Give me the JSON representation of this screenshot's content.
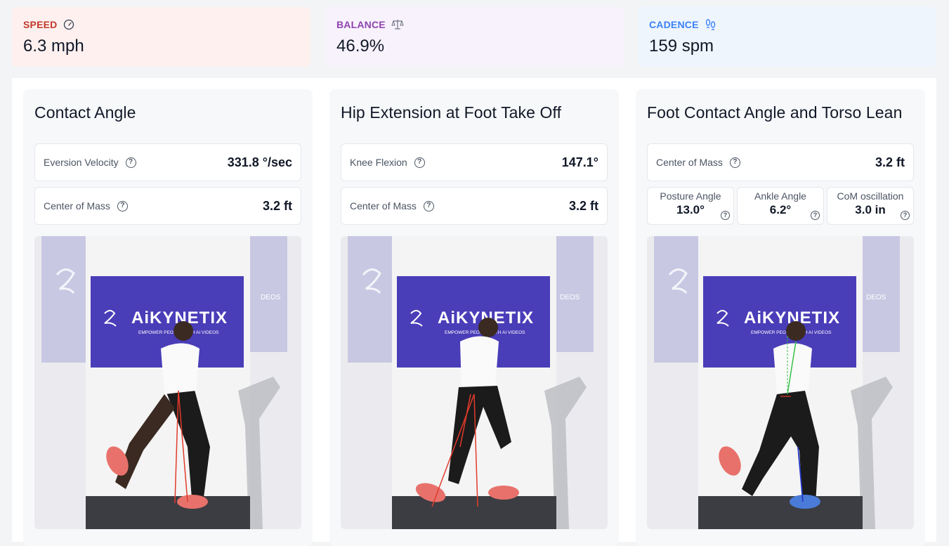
{
  "stats": [
    {
      "label": "SPEED",
      "value": "6.3 mph",
      "icon": "speedometer-icon",
      "color": "#c0392b"
    },
    {
      "label": "BALANCE",
      "value": "46.9%",
      "icon": "scale-icon",
      "color": "#8e44ad"
    },
    {
      "label": "CADENCE",
      "value": "159 spm",
      "icon": "footprints-icon",
      "color": "#3b82f6"
    }
  ],
  "cards": [
    {
      "title": "Contact Angle",
      "metrics": [
        {
          "label": "Eversion Velocity",
          "value": "331.8 °/sec"
        },
        {
          "label": "Center of Mass",
          "value": "3.2 ft"
        }
      ]
    },
    {
      "title": "Hip Extension at Foot Take Off",
      "metrics": [
        {
          "label": "Knee Flexion",
          "value": "147.1°"
        },
        {
          "label": "Center of Mass",
          "value": "3.2 ft"
        }
      ]
    },
    {
      "title": "Foot Contact Angle and Torso Lean",
      "metrics": [
        {
          "label": "Center of Mass",
          "value": "3.2 ft"
        }
      ],
      "mini_metrics": [
        {
          "label": "Posture Angle",
          "value": "13.0°"
        },
        {
          "label": "Ankle Angle",
          "value": "6.2°"
        },
        {
          "label": "CoM oscillation",
          "value": "3.0 in"
        }
      ]
    }
  ],
  "video": {
    "brand": "AiKYNETIX",
    "tagline": "EMPOWER PEOPLE WITH AI VIDEOS",
    "side_text": "DEOS"
  }
}
